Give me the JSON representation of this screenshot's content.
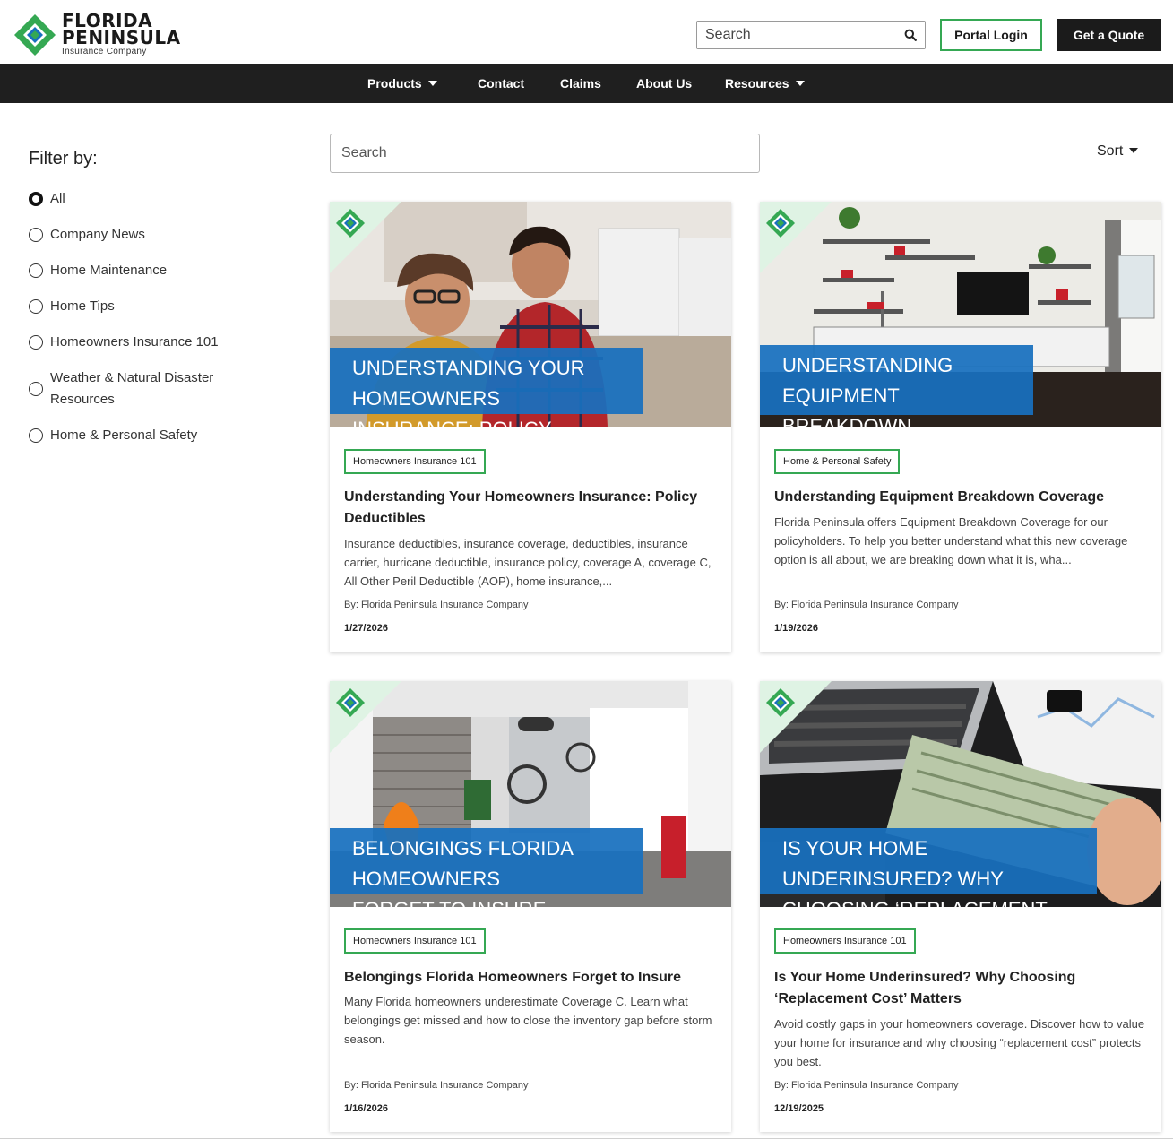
{
  "brand": {
    "line1": "FLORIDA",
    "line2": "PENINSULA",
    "line3": "Insurance Company",
    "green": "#35a853",
    "blue": "#1870be"
  },
  "header": {
    "search_placeholder": "Search",
    "portal_login": "Portal Login",
    "get_quote": "Get a Quote"
  },
  "nav": {
    "items": [
      "Products",
      "Contact",
      "Claims",
      "About Us",
      "Resources"
    ]
  },
  "filter": {
    "title": "Filter by:",
    "options": [
      "All",
      "Company News",
      "Home Maintenance",
      "Home Tips",
      "Homeowners Insurance 101",
      "Weather & Natural Disaster Resources",
      "Home & Personal Safety"
    ],
    "selected": "All"
  },
  "main": {
    "search_placeholder": "Search",
    "sort_label": "Sort"
  },
  "cards": [
    {
      "banner": [
        "UNDERSTANDING YOUR HOMEOWNERS",
        "INSURANCE: POLICY DEDUCTIBLES"
      ],
      "tag": "Homeowners Insurance 101",
      "title": "Understanding Your Homeowners Insurance: Policy Deductibles",
      "desc": "Insurance deductibles, insurance coverage, deductibles, insurance carrier, hurricane deductible, insurance policy, coverage A, coverage C, All Other Peril Deductible (AOP), home insurance,...",
      "by": "By: Florida Peninsula Insurance Company",
      "date": "1/27/2026",
      "image": "couple-at-computer"
    },
    {
      "banner": [
        "UNDERSTANDING EQUIPMENT",
        "BREAKDOWN COVERAGE"
      ],
      "tag": "Home & Personal Safety",
      "title": "Understanding Equipment Breakdown Coverage",
      "desc": "Florida Peninsula offers Equipment Breakdown Coverage for our policyholders. To help you better understand what this new coverage option is all about, we are breaking down what it is, wha...",
      "by": "By: Florida Peninsula Insurance Company",
      "date": "1/19/2026",
      "image": "living-room-tv"
    },
    {
      "banner": [
        "BELONGINGS FLORIDA HOMEOWNERS",
        "FORGET TO INSURE"
      ],
      "tag": "Homeowners Insurance 101",
      "title": "Belongings Florida Homeowners Forget to Insure",
      "desc": "Many Florida homeowners underestimate Coverage C. Learn what belongings get missed and how to close the inventory gap before storm season.",
      "by": "By: Florida Peninsula Insurance Company",
      "date": "1/16/2026",
      "image": "garage"
    },
    {
      "banner": [
        "IS YOUR HOME UNDERINSURED? WHY",
        "CHOOSING ‘REPLACEMENT COST’ MATTERS"
      ],
      "tag": "Homeowners Insurance 101",
      "title": "Is Your Home Underinsured? Why Choosing ‘Replacement Cost’ Matters",
      "desc": "Avoid costly gaps in your homeowners coverage. Discover how to value your home for insurance and why choosing “replacement cost” protects you best.",
      "by": "By: Florida Peninsula Insurance Company",
      "date": "12/19/2025",
      "image": "cash-and-laptop"
    }
  ]
}
